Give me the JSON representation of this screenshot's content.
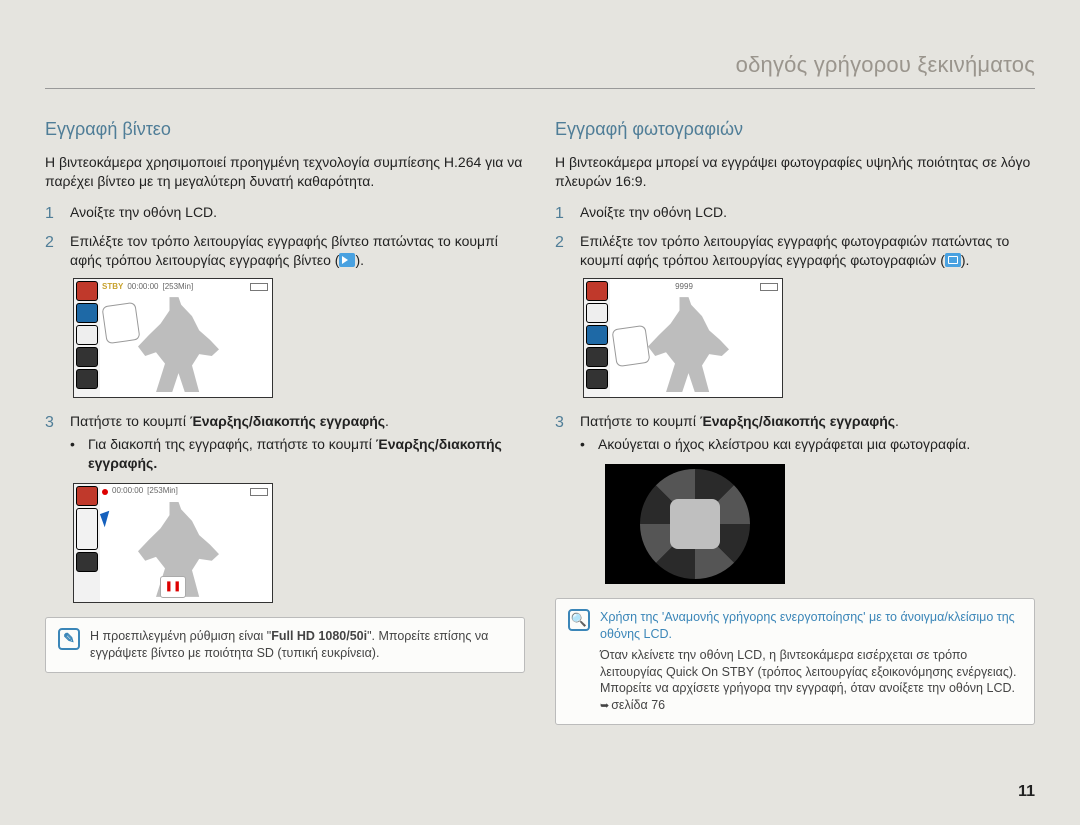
{
  "page_header": "οδηγός γρήγορου ξεκινήματος",
  "page_number": "11",
  "left": {
    "title": "Εγγραφή βίντεο",
    "intro": "Η βιντεοκάμερα χρησιμοποιεί προηγμένη τεχνολογία συμπίεσης H.264 για να παρέχει βίντεο με τη μεγαλύτερη δυνατή καθαρότητα.",
    "steps": [
      {
        "num": "1",
        "text": "Ανοίξτε την οθόνη LCD."
      },
      {
        "num": "2",
        "text": "Επιλέξτε τον τρόπο λειτουργίας εγγραφής βίντεο πατώντας το κουμπί αφής τρόπου λειτουργίας εγγραφής βίντεο  (",
        "text_end": ")."
      },
      {
        "num": "3",
        "text": "Πατήστε το κουμπί ",
        "bold": "Έναρξης/διακοπής εγγραφής",
        "tail": "."
      }
    ],
    "bullet_pre": "Για διακοπή της εγγραφής, πατήστε το κουμπί ",
    "bullet_bold": "Έναρξης/διακοπής εγγραφής.",
    "overlay1": {
      "stby": "STBY",
      "time": "00:00:00",
      "remain": "[253Min]"
    },
    "overlay2": {
      "time": "00:00:00",
      "remain": "[253Min]"
    },
    "note_a": "Η προεπιλεγμένη ρύθμιση είναι \"",
    "note_bold": "Full HD 1080/50i",
    "note_b": "\". Μπορείτε επίσης να εγγράψετε βίντεο με ποιότητα SD (τυπική ευκρίνεια)."
  },
  "right": {
    "title": "Εγγραφή φωτογραφιών",
    "intro": "Η βιντεοκάμερα μπορεί να εγγράψει φωτογραφίες υψηλής ποιότητας σε λόγο πλευρών 16:9.",
    "steps": [
      {
        "num": "1",
        "text": "Ανοίξτε την οθόνη LCD."
      },
      {
        "num": "2",
        "text": "Επιλέξτε τον τρόπο λειτουργίας εγγραφής φωτογραφιών πατώντας το κουμπί αφής τρόπου λειτουργίας εγγραφής φωτογραφιών (",
        "text_end": ")."
      },
      {
        "num": "3",
        "text": "Πατήστε το κουμπί ",
        "bold": "Έναρξης/διακοπής εγγραφής",
        "tail": "."
      }
    ],
    "bullet": "Ακούγεται ο ήχος κλείστρου και εγγράφεται μια φωτογραφία.",
    "overlay": {
      "count": "9999"
    },
    "note_head": "Χρήση της 'Αναμονής γρήγορης ενεργοποίησης' με το άνοιγμα/κλείσιμο της οθόνης LCD.",
    "note_body": "Όταν κλείνετε την οθόνη LCD, η βιντεοκάμερα εισέρχεται σε τρόπο λειτουργίας Quick On STBY (τρόπος λειτουργίας εξοικονόμησης ενέργειας). Μπορείτε να αρχίσετε γρήγορα την εγγραφή, όταν ανοίξετε την οθόνη LCD. ",
    "note_ref": "σελίδα 76"
  }
}
